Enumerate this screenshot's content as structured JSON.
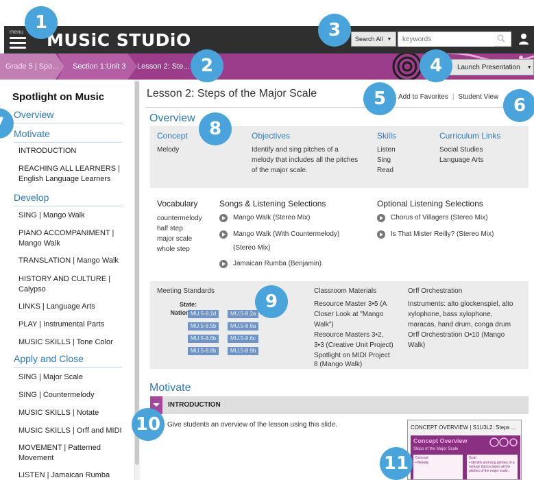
{
  "app": {
    "logo": "MUSiC STUDiO",
    "menu_label": "menu"
  },
  "search": {
    "scope": "Search All",
    "placeholder": "keywords"
  },
  "breadcrumb": [
    "Grade 5 | Spo...",
    "Section 1:Unit 3",
    "Lesson 2: Ste..."
  ],
  "launch_label": "Launch Presentation",
  "sidebar": {
    "title": "Spotlight on Music",
    "overview": "Overview",
    "sections": [
      {
        "label": "Motivate",
        "items": [
          "INTRODUCTION",
          "REACHING ALL LEARNERS | English Language Learners"
        ]
      },
      {
        "label": "Develop",
        "items": [
          "SING | Mango Walk",
          "PIANO ACCOMPANIMENT | Mango Walk",
          "TRANSLATION | Mango Walk",
          "HISTORY AND CULTURE | Calypso",
          "LINKS | Language Arts",
          "PLAY | Instrumental Parts",
          "MUSIC SKILLS | Tone Color"
        ]
      },
      {
        "label": "Apply and Close",
        "items": [
          "SING | Major Scale",
          "SING | Countermelody",
          "MUSIC SKILLS | Notate",
          "MUSIC SKILLS | Orff and MIDI",
          "MOVEMENT | Patterned Movement",
          "LISTEN | Jamaican Rumba"
        ]
      }
    ]
  },
  "lesson": {
    "title": "Lesson 2: Steps of the Major Scale",
    "add_favorites": "Add to Favorites",
    "student_view": "Student View",
    "overview_heading": "Overview",
    "concept": {
      "heading": "Concept",
      "value": "Melody"
    },
    "objectives": {
      "heading": "Objectives",
      "text": [
        "Identify and sing pitches of a",
        "melody that includes all the pitches",
        "of the major scale."
      ]
    },
    "skills": {
      "heading": "Skills",
      "items": [
        "Listen",
        "Sing",
        "Read"
      ]
    },
    "curriculum": {
      "heading": "Curriculum Links",
      "items": [
        "Social Studies",
        "Language Arts"
      ]
    },
    "vocabulary": {
      "heading": "Vocabulary",
      "items": [
        "countermelody",
        "half step",
        "major scale",
        "whole step"
      ]
    },
    "songs": {
      "heading": "Songs & Listening Selections",
      "items": [
        "Mango Walk (Stereo Mix)",
        "Mango Walk (With Countermelody)",
        "(Stereo Mix)",
        "Jamaican Rumba (Benjamin)"
      ]
    },
    "optional": {
      "heading": "Optional Listening Selections",
      "items": [
        "Chorus of Villagers (Stereo Mix)",
        "Is That Mister Reilly? (Stereo Mix)"
      ]
    },
    "standards": {
      "heading": "Meeting Standards",
      "state_label": "State:",
      "national_label": "National:",
      "tags": [
        "MU.5-8.1d",
        "MU.5-8.2a",
        "MU.5-8.5b",
        "MU.5-8.6a",
        "MU.5-8.6b",
        "MU.5-8.6c",
        "MU.5-8.8b",
        "MU.5-8.9b"
      ]
    },
    "materials": {
      "heading": "Classroom Materials",
      "text": [
        "Resource Master 3•5 (A",
        "Closer Look at \"Mango",
        "Walk\")",
        "Resource Masters 3•2,",
        "3•3 (Creative Unit Project)",
        "Spotlight on MIDI Project",
        "8 (Mango Walk)"
      ]
    },
    "orff": {
      "heading": "Orff Orchestration",
      "text": [
        "Instruments: alto glockenspiel, alto",
        "xylophone, bass xylophone,",
        "maracas, hand drum, conga drum",
        "Orff Orchestration O•10 (Mango",
        "Walk)"
      ]
    },
    "motivate_heading": "Motivate",
    "intro_label": "INTRODUCTION",
    "intro_text": "Give students an overview of the lesson using this slide.",
    "thumb": {
      "title": "CONCEPT OVERVIEW | S1U3L2: Steps ...",
      "slide_title": "Concept Overview",
      "slide_sub": "Steps of the Major Scale",
      "concept": "Concept",
      "concept_val": "• Melody",
      "goal": "Goal",
      "goal_val": "• Identify and sing pitches of a melody that includes all the pitches of the major scale."
    }
  },
  "badges": [
    "1",
    "2",
    "3",
    "4",
    "5",
    "6",
    "7",
    "8",
    "9",
    "10",
    "11"
  ],
  "colors": {
    "accent_blue": "#2a7abf",
    "badge_blue": "#4aa4dc",
    "magenta": "#9b3d8b",
    "topbar": "#2f2f2f"
  }
}
